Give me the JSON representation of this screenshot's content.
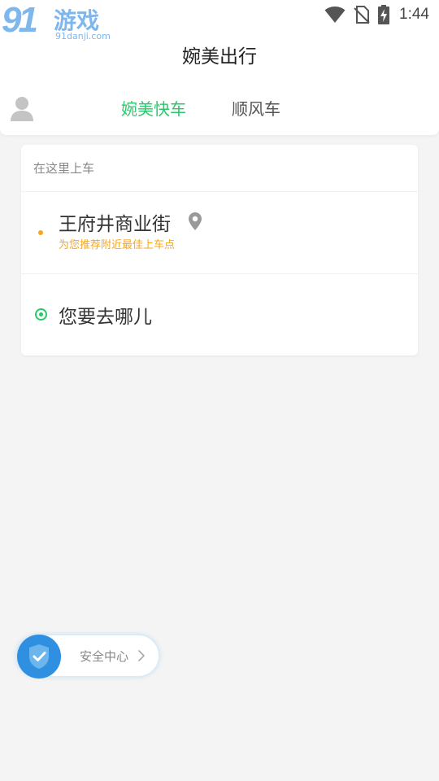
{
  "watermark": {
    "big": "91",
    "cn": "游戏",
    "domain": "91danji.com"
  },
  "status_bar": {
    "time": "1:44",
    "icons": [
      "wifi-icon",
      "no-sim-icon",
      "battery-charging-icon"
    ]
  },
  "header": {
    "title": "婉美出行",
    "tabs": [
      {
        "label": "婉美快车",
        "active": true
      },
      {
        "label": "顺风车",
        "active": false
      }
    ]
  },
  "trip": {
    "pickup_hint": "在这里上车",
    "pickup_location": "王府井商业街",
    "pickup_recommend": "为您推荐附近最佳上车点",
    "destination_placeholder": "您要去哪儿"
  },
  "safety": {
    "label": "安全中心"
  },
  "colors": {
    "accent": "#2bc76a",
    "warning": "#f5a623",
    "safety_blue": "#2f8fe0"
  }
}
